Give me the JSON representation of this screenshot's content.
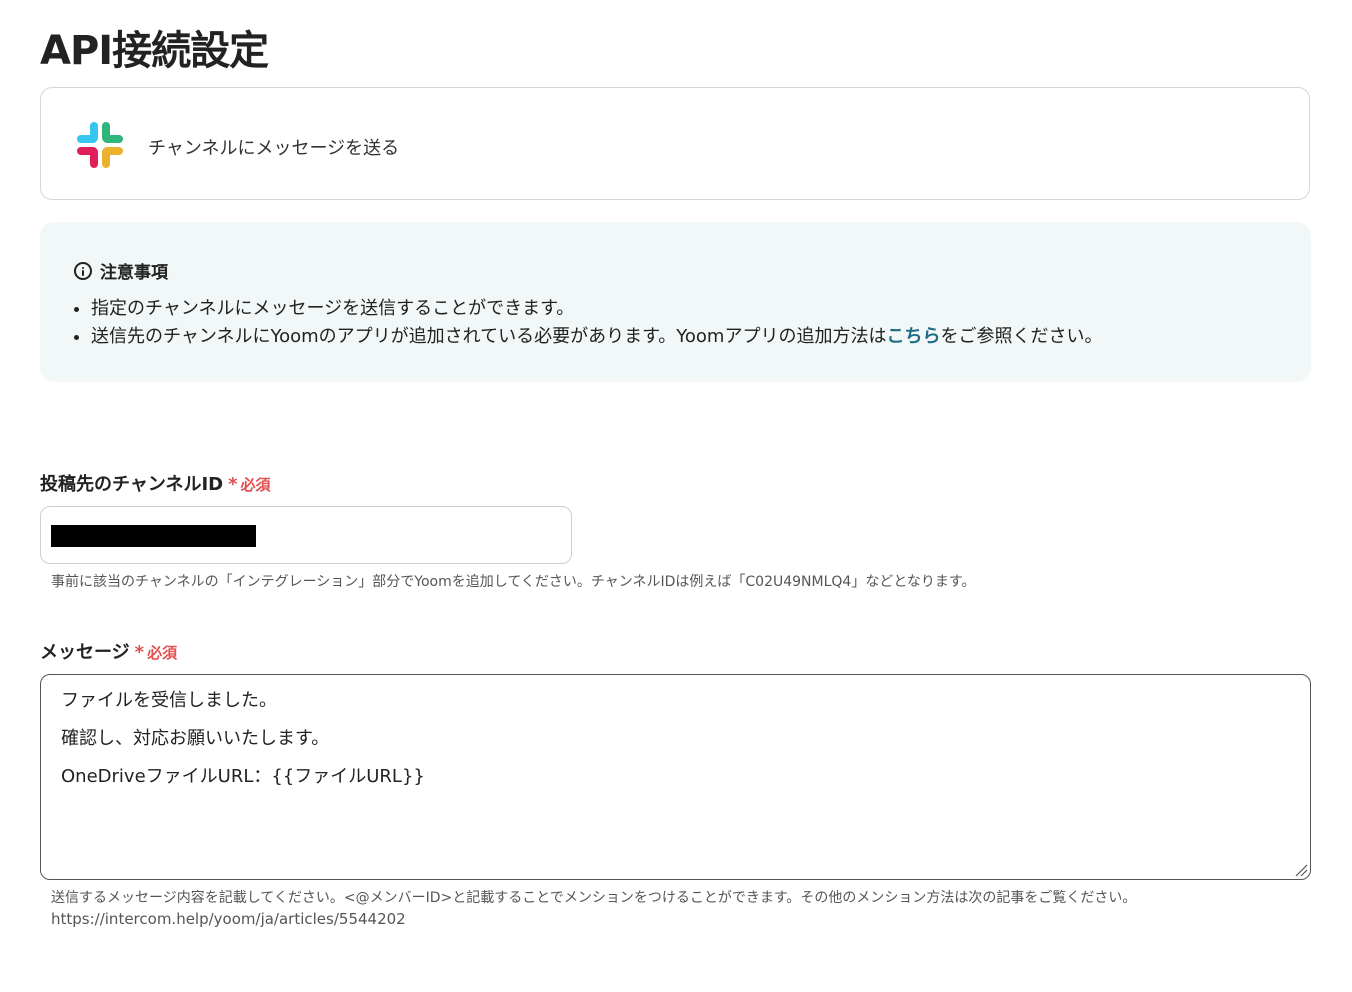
{
  "page": {
    "title": "API接続設定"
  },
  "action": {
    "icon": "slack-logo-icon",
    "label": "チャンネルにメッセージを送る"
  },
  "notice": {
    "title": "注意事項",
    "items": [
      {
        "text": "指定のチャンネルにメッセージを送信することができます。"
      },
      {
        "text_before": "送信先のチャンネルにYoomのアプリが追加されている必要があります。Yoomアプリの追加方法は",
        "link": "こちら",
        "text_after": "をご参照ください。"
      }
    ]
  },
  "channel_field": {
    "label": "投稿先のチャンネルID",
    "required_star": "*",
    "required_text": "必須",
    "help": "事前に該当のチャンネルの「インテグレーション」部分でYoomを追加してください。チャンネルIDは例えば「C02U49NMLQ4」などとなります。"
  },
  "message_field": {
    "label": "メッセージ",
    "required_star": "*",
    "required_text": "必須",
    "lines": [
      "ファイルを受信しました。",
      "確認し、対応お願いいたします。",
      "OneDriveファイルURL：{{ファイルURL}}"
    ],
    "help": "送信するメッセージ内容を記載してください。<@メンバーID>と記載することでメンションをつけることができます。その他のメンション方法は次の記事をご覧ください。",
    "help_url": "https://intercom.help/yoom/ja/articles/5544202"
  },
  "colors": {
    "accent_link": "#1f6c84",
    "required": "#e05050",
    "notice_bg": "#f2f7f7"
  }
}
